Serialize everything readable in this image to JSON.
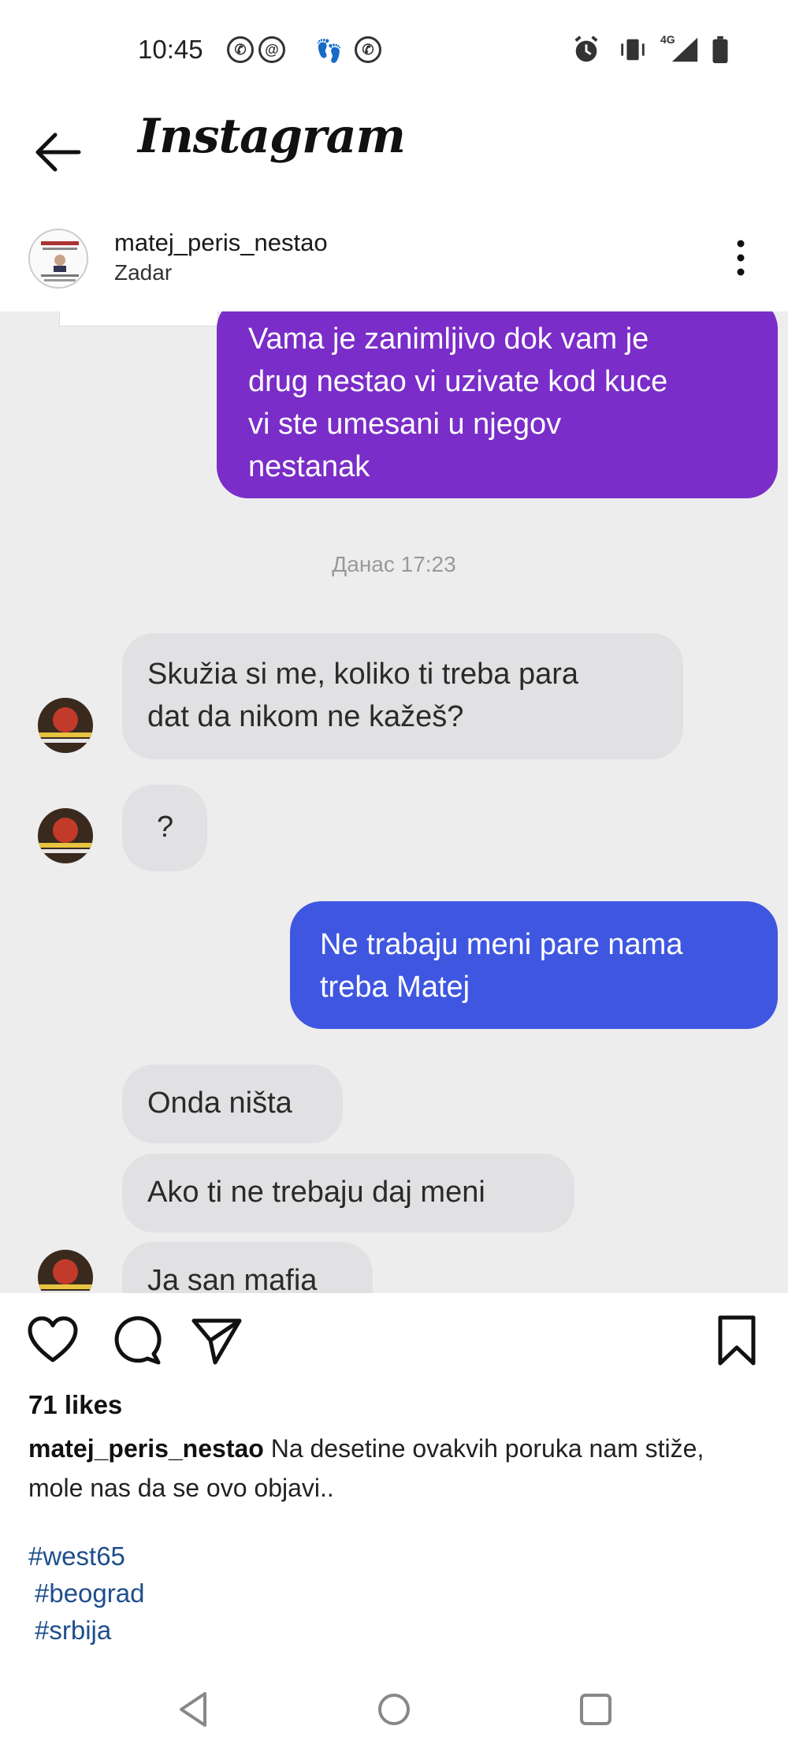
{
  "status_bar": {
    "time": "10:45",
    "network": "4G"
  },
  "header": {
    "app_title": "Instagram"
  },
  "post": {
    "username": "matej_peris_nestao",
    "location": "Zadar",
    "likes": "71 likes",
    "caption_user": "matej_peris_nestao",
    "caption_text": "Na desetine ovakvih poruka nam stiže, mole nas da se ovo objavi..",
    "hashtags": [
      "#west65",
      "#beograd",
      "#srbija"
    ]
  },
  "chat": {
    "msg_purple": [
      "Vama je zanimljivo dok vam je",
      "drug nestao vi uzivate kod kuce",
      "vi ste umesani u njegov",
      "nestanak"
    ],
    "timestamp": "Данас 17:23",
    "msg_in_1": [
      "Skužia si me, koliko ti treba para",
      "dat da nikom ne kažeš?"
    ],
    "msg_in_2": "?",
    "msg_blue": [
      "Ne trabaju meni pare nama",
      "treba Matej"
    ],
    "msg_in_3": "Onda ništa",
    "msg_in_4": "Ako ti ne trebaju daj meni",
    "msg_in_5": "Ja san mafia"
  },
  "colors": {
    "purple": "#7a2dc8",
    "blue": "#3f57e0",
    "link": "#1f4e8c"
  },
  "icons": [
    "back-arrow-icon",
    "dots-vertical-icon",
    "heart-icon",
    "comment-icon",
    "send-icon",
    "bookmark-icon",
    "nav-back-icon",
    "nav-home-icon",
    "nav-recents-icon"
  ]
}
